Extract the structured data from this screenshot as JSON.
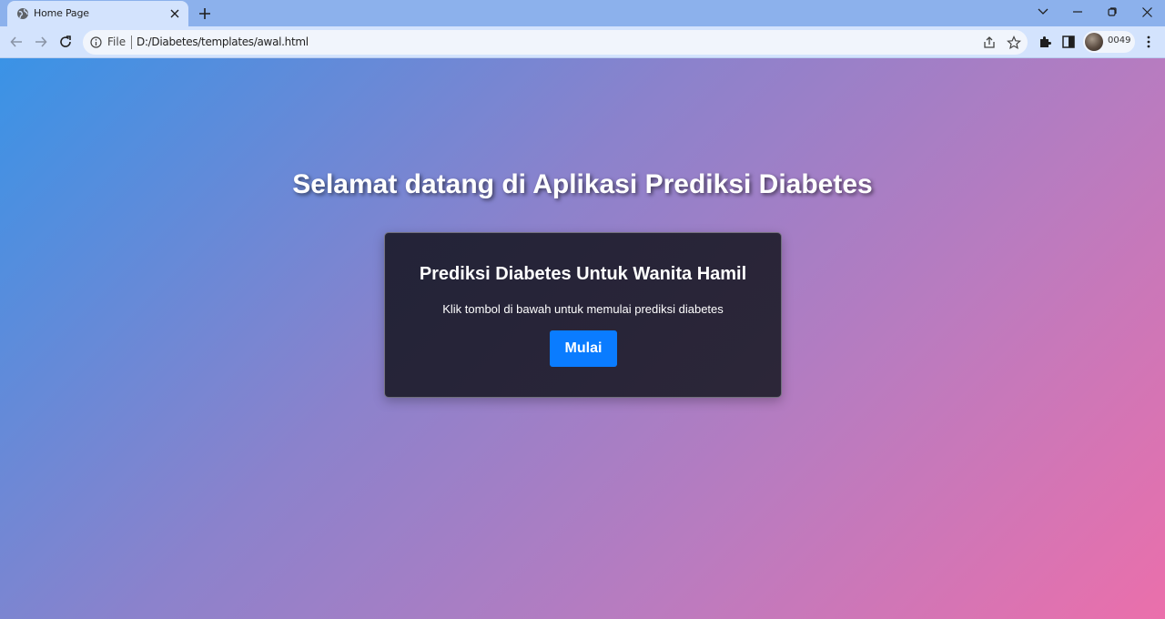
{
  "browser": {
    "tab": {
      "title": "Home Page",
      "favicon": "globe-icon"
    },
    "address_bar": {
      "security_label": "File",
      "url": "D:/Diabetes/templates/awal.html"
    },
    "profile": {
      "label": "0049"
    }
  },
  "page": {
    "heading": "Selamat datang di Aplikasi Prediksi Diabetes",
    "card": {
      "title": "Prediksi Diabetes Untuk Wanita Hamil",
      "description": "Klik tombol di bawah untuk memulai prediksi diabetes",
      "button_label": "Mulai"
    }
  },
  "colors": {
    "gradient_start": "#3a93e6",
    "gradient_end": "#eb6fab",
    "card_background": "#24243a",
    "button": "#0a7cff"
  }
}
